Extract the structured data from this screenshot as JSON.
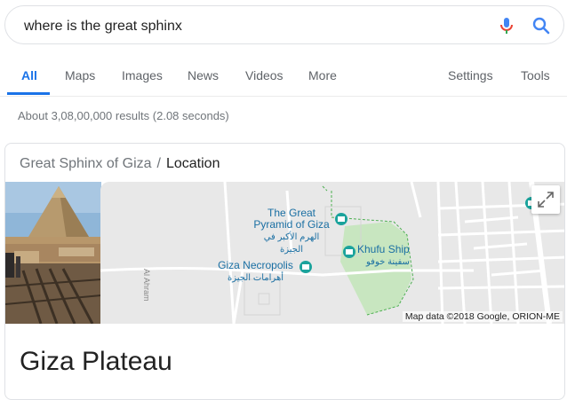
{
  "search": {
    "query": "where is the great sphinx"
  },
  "tabs": [
    {
      "label": "All"
    },
    {
      "label": "Maps"
    },
    {
      "label": "Images"
    },
    {
      "label": "News"
    },
    {
      "label": "Videos"
    },
    {
      "label": "More"
    }
  ],
  "tools": {
    "settings": "Settings",
    "tools": "Tools"
  },
  "results_stats": "About 3,08,00,000 results (2.08 seconds)",
  "card": {
    "breadcrumb_main": "Great Sphinx of Giza",
    "breadcrumb_sep": "/",
    "breadcrumb_current": "Location",
    "title": "Giza Plateau",
    "map": {
      "places": [
        {
          "name": "The Great",
          "name2": "Pyramid of Giza",
          "arabic": "الهرم الأكبر في الجيزة"
        },
        {
          "name": "Khufu Ship",
          "arabic": "سفينة خوفو"
        },
        {
          "name": "Giza Necropolis",
          "arabic": "أهرامات الجيزة"
        }
      ],
      "road": "Al Ahram",
      "attribution": "Map data ©2018 Google, ORION-ME"
    }
  },
  "colors": {
    "accent": "#1a73e8",
    "marker": "#1ba39c",
    "park": "#c8e6c0"
  },
  "icons": [
    "mic-icon",
    "search-icon",
    "expand-icon",
    "museum-marker-icon"
  ]
}
